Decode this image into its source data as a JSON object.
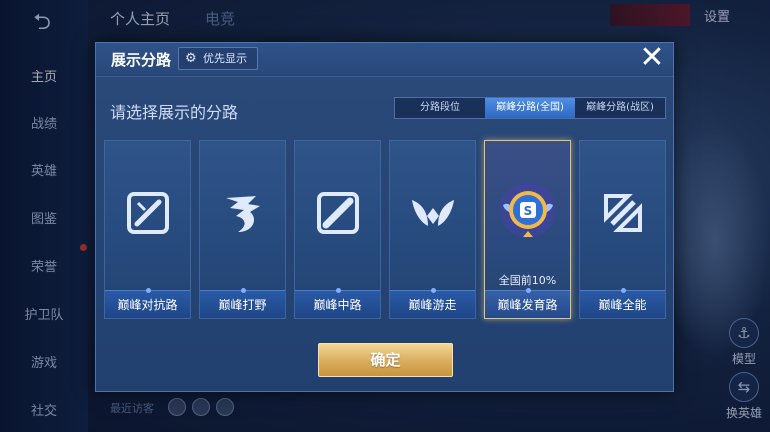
{
  "background": {
    "back_icon": "back-arrow-icon",
    "tabs": [
      "个人主页",
      "电竞"
    ],
    "settings_label": "设置",
    "sidebar": {
      "items": [
        {
          "label": "主页",
          "active": true
        },
        {
          "label": "战绩",
          "active": false
        },
        {
          "label": "英雄",
          "active": false
        },
        {
          "label": "图鉴",
          "active": false
        },
        {
          "label": "荣誉",
          "active": false
        },
        {
          "label": "护卫队",
          "active": false
        },
        {
          "label": "游戏",
          "active": false
        },
        {
          "label": "社交",
          "active": false
        }
      ]
    },
    "right_buttons": [
      {
        "label": "模型",
        "icon": "model-icon"
      },
      {
        "label": "换英雄",
        "icon": "swap-hero-icon"
      }
    ],
    "visitors_label": "最近访客"
  },
  "modal": {
    "title": "展示分路",
    "priority_button": "优先显示",
    "close_icon": "close-icon",
    "section_title": "请选择展示的分路",
    "segments": [
      {
        "label": "分路段位",
        "active": false
      },
      {
        "label": "巅峰分路(全国)",
        "active": true
      },
      {
        "label": "巅峰分路(战区)",
        "active": false
      }
    ],
    "cards": [
      {
        "label": "巅峰对抗路",
        "icon": "sword-lane-icon",
        "selected": false
      },
      {
        "label": "巅峰打野",
        "icon": "dragon-jungle-icon",
        "selected": false
      },
      {
        "label": "巅峰中路",
        "icon": "mid-lane-icon",
        "selected": false
      },
      {
        "label": "巅峰游走",
        "icon": "wings-roam-icon",
        "selected": false
      },
      {
        "label": "巅峰发育路",
        "icon": "national-rank-badge-icon",
        "selected": true,
        "rank": "全国前10%"
      },
      {
        "label": "巅峰全能",
        "icon": "allround-icon",
        "selected": false
      }
    ],
    "confirm_button": "确定"
  },
  "colors": {
    "modal_bg": "#244370",
    "segment_active": "#3a78d6",
    "confirm_gold": "#d9ad5c",
    "selected_border": "#e3c37a"
  }
}
